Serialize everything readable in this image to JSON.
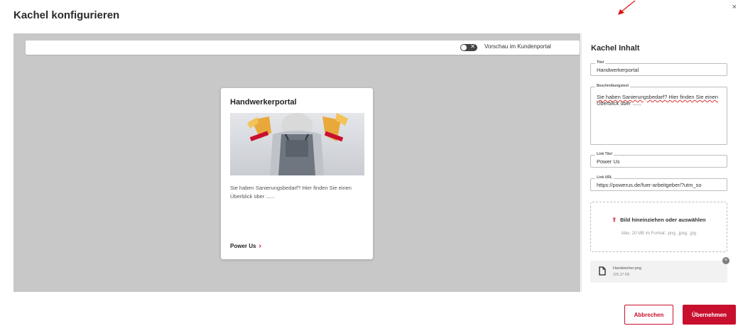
{
  "dialog": {
    "title": "Kachel konfigurieren",
    "close_glyph": "×"
  },
  "preview": {
    "toggle_label": "Vorschau im Kundenportal",
    "toggle_glyph": "✕",
    "toggle_on": false,
    "tile": {
      "title": "Handwerkerportal",
      "description": "Sie haben Sanierungsbedarf? Hier finden Sie einen Überblick über ......",
      "link_label": "Power Us",
      "link_chevron": "›"
    }
  },
  "panel": {
    "title": "Kachel Inhalt",
    "fields": {
      "title_legend": "Titel",
      "title_value": "Handwerkerportal",
      "desc_legend": "Beschreibungstext",
      "desc_value": "Sie haben Sanierungsbedarf? Hier finden Sie einen Überblick über ......",
      "link_title_legend": "Link Titel",
      "link_title_value": "Power Us",
      "link_url_legend": "Link URL",
      "link_url_value": "https://powerus.de/fuer-arbeitgeber/?utm_so"
    },
    "dropzone": {
      "icon_glyph": "⇪",
      "label": "Bild hineinziehen oder auswählen",
      "hint": "Max. 20 MB im Format: .png, .jpeg, .jpg"
    },
    "file": {
      "name": "Handwerker.png",
      "size": "225.37 KB",
      "remove_glyph": "×"
    }
  },
  "buttons": {
    "cancel": "Abbrechen",
    "apply": "Übernehmen"
  },
  "colors": {
    "accent": "#c8102e",
    "preview_bg": "#c8c8c8"
  }
}
